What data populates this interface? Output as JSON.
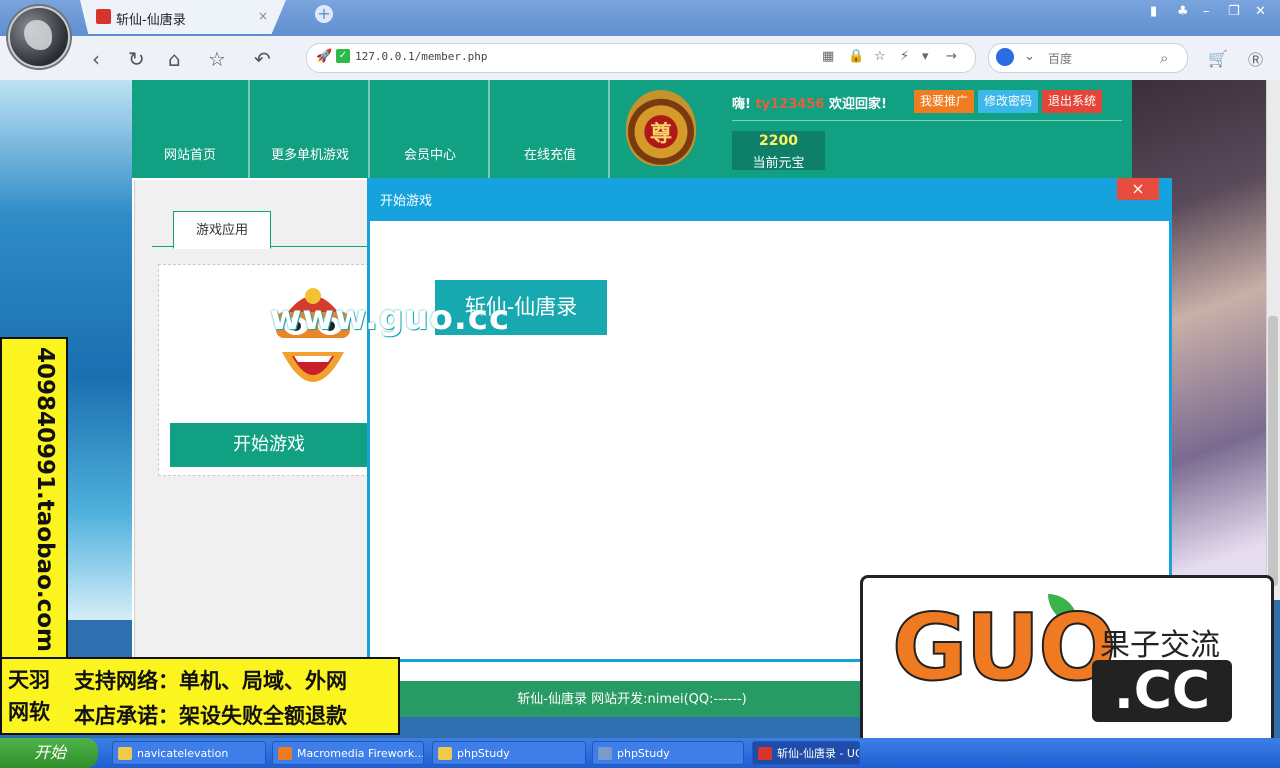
{
  "browser": {
    "tab_title": "斩仙-仙唐录",
    "tab_close": "×",
    "new_tab": "+",
    "url": "127.0.0.1/member.php",
    "search_placeholder": "百度"
  },
  "site": {
    "nav": [
      "网站首页",
      "更多单机游戏",
      "会员中心",
      "在线充值"
    ],
    "emblem_char": "尊",
    "greeting_prefix": "嗨!",
    "username": "ty123456",
    "greeting_suffix": "欢迎回家!",
    "buttons": {
      "promote": "我要推广",
      "change_password": "修改密码",
      "logout": "退出系统"
    },
    "balance_value": "2200",
    "balance_label": "当前元宝"
  },
  "panel": {
    "tab_label": "游戏应用",
    "start_button": "开始游戏"
  },
  "modal": {
    "title": "开始游戏",
    "close": "×",
    "game_tile": "斩仙-仙唐录",
    "watermark": "www.guo.cc"
  },
  "footer": {
    "text": "斩仙-仙唐录   网站开发:nimei(QQ:------)"
  },
  "ads": {
    "vertical": "409840991.taobao.com",
    "brand_line1": "天羽",
    "brand_line2": "网软",
    "line1": "支持网络：单机、局域、外网",
    "line2": "本店承诺：架设失败全额退款"
  },
  "logo": {
    "big": "GUO",
    "cn": "果子交流",
    "cc": ".CC"
  },
  "taskbar": {
    "start": "开始",
    "tasks": [
      "navicatelevation",
      "Macromedia Firework...",
      "phpStudy",
      "phpStudy",
      "斩仙-仙唐录 - UC"
    ]
  },
  "colors": {
    "primary": "#12a082",
    "modal": "#16a3dd",
    "footer": "#279b63",
    "close": "#e74c3c"
  }
}
